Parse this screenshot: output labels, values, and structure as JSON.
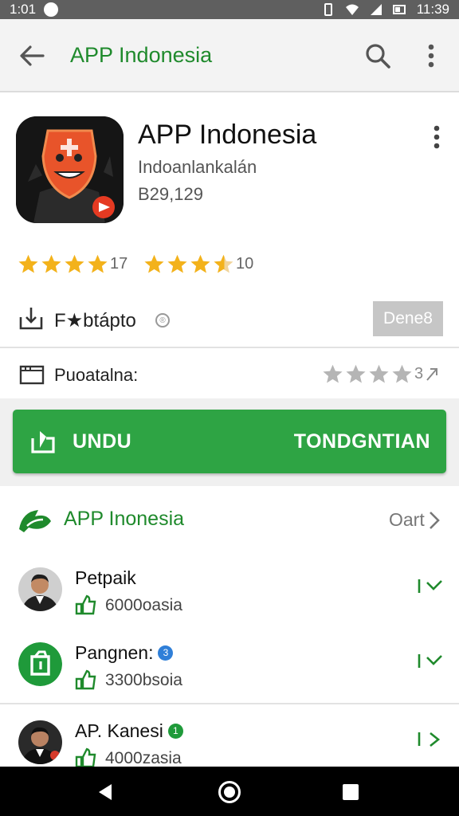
{
  "status_bar": {
    "time_left": "1:01",
    "time_right": "11:39"
  },
  "toolbar": {
    "title": "APP Indonesia",
    "back_icon": "arrow-left-icon",
    "search_icon": "search-icon",
    "more_icon": "more-vert-icon"
  },
  "app": {
    "name": "APP Indonesia",
    "developer": "Indoanlankalán",
    "count": "B29,129",
    "icon": "app-mascot-icon"
  },
  "ratings": [
    {
      "stars": 4,
      "value": "17"
    },
    {
      "stars": 4.5,
      "value": "10"
    }
  ],
  "install": {
    "label": "F★btápto",
    "badge": "®",
    "button": "Dene8"
  },
  "category": {
    "label": "Puoatalna:",
    "stars": 4,
    "value": "3"
  },
  "primary_button": {
    "left_label": "UNDU",
    "right_label": "TONDGNTIAN"
  },
  "section": {
    "title": "APP Inonesia",
    "more_label": "Oart"
  },
  "list": [
    {
      "name": "Petpaik",
      "subtitle": "6000oasia",
      "badge": "",
      "avatar": "person-avatar"
    },
    {
      "name": "Pangnen:",
      "subtitle": "3300bsoia",
      "badge": "3",
      "avatar": "green-app-avatar"
    },
    {
      "name": "AP. Kanesi",
      "subtitle": "4000zasia",
      "badge": "1",
      "avatar": "person-avatar"
    }
  ],
  "colors": {
    "accent": "#1f8a2c",
    "button": "#2ea444",
    "star": "#f3b21b",
    "star_gray": "#b5b5b5"
  }
}
